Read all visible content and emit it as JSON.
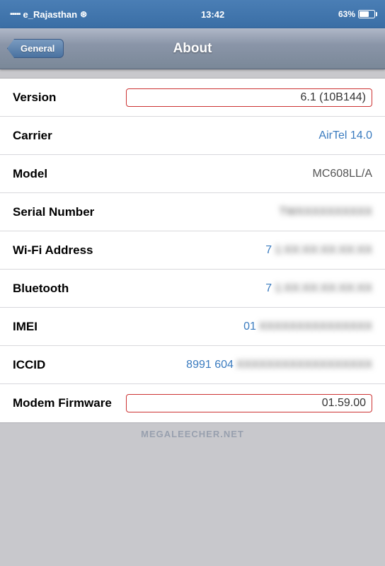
{
  "statusBar": {
    "carrier": "e_Rajasthan",
    "wifi": "WiFi",
    "time": "13:42",
    "battery": "63%"
  },
  "navBar": {
    "backLabel": "General",
    "title": "About"
  },
  "rows": [
    {
      "label": "Version",
      "value": "6.1 (10B144)",
      "valueType": "highlighted",
      "blurredPart": ""
    },
    {
      "label": "Carrier",
      "value": "AirTel 14.0",
      "valueType": "blue",
      "blurredPart": ""
    },
    {
      "label": "Model",
      "value": "MC608LL/A",
      "valueType": "normal",
      "blurredPart": ""
    },
    {
      "label": "Serial Number",
      "value": "",
      "valueType": "blurred",
      "blurredPart": "TWXXXXXXXX"
    },
    {
      "label": "Wi-Fi Address",
      "partialValue": "7",
      "valueType": "partial-blur",
      "blurredPart": "1:XX:XX:XX:XX:XX"
    },
    {
      "label": "Bluetooth",
      "partialValue": "7",
      "valueType": "partial-blur",
      "blurredPart": "1:XX:XX:XX:XX:XX"
    },
    {
      "label": "IMEI",
      "partialValue": "01",
      "valueType": "partial-blur",
      "blurredPart": "XXXXXXXXXXXXXXX"
    },
    {
      "label": "ICCID",
      "partialValue": "8991 604",
      "valueType": "partial-blur",
      "blurredPart": "XXXXXXXXXXXXXXXXXX"
    },
    {
      "label": "Modem Firmware",
      "value": "01.59.00",
      "valueType": "highlighted",
      "blurredPart": ""
    }
  ],
  "watermark": "MEGALEECHER.NET"
}
